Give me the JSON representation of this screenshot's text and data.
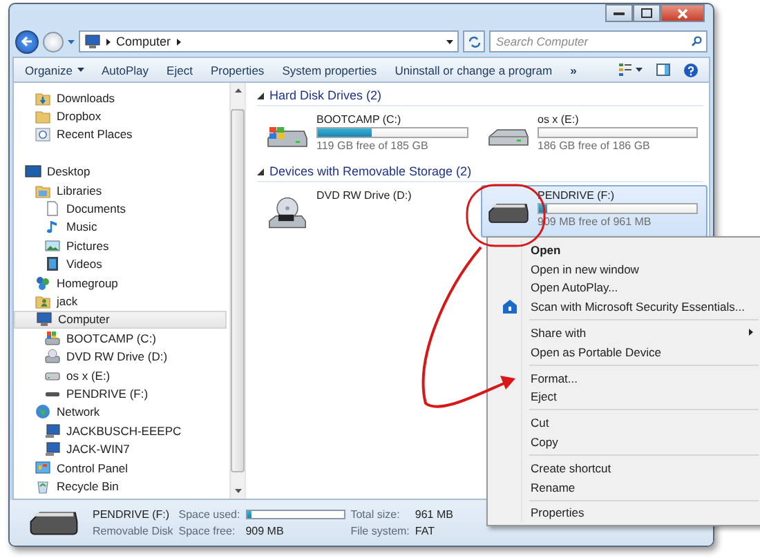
{
  "address_bar": {
    "path": [
      "Computer"
    ]
  },
  "search": {
    "placeholder": "Search Computer"
  },
  "toolbar": {
    "buttons": [
      {
        "label": "Organize",
        "kind": "dropdown"
      },
      {
        "label": "AutoPlay",
        "kind": "plain"
      },
      {
        "label": "Eject",
        "kind": "plain"
      },
      {
        "label": "Properties",
        "kind": "plain"
      },
      {
        "label": "System properties",
        "kind": "plain"
      },
      {
        "label": "Uninstall or change a program",
        "kind": "plain"
      }
    ],
    "overflow": "»"
  },
  "sidebar": {
    "favorites": [
      {
        "label": "Downloads",
        "kind": "downloads",
        "selected": false
      },
      {
        "label": "Dropbox",
        "kind": "folder",
        "selected": false
      },
      {
        "label": "Recent Places",
        "kind": "recent",
        "selected": false
      }
    ],
    "tree": [
      {
        "label": "Desktop",
        "kind": "desktop",
        "selected": false,
        "children": [
          {
            "label": "Libraries",
            "kind": "library",
            "selected": false,
            "children": [
              {
                "label": "Documents",
                "kind": "document",
                "selected": false
              },
              {
                "label": "Music",
                "kind": "music",
                "selected": false
              },
              {
                "label": "Pictures",
                "kind": "picture",
                "selected": false
              },
              {
                "label": "Videos",
                "kind": "video",
                "selected": false
              }
            ]
          },
          {
            "label": "Homegroup",
            "kind": "homegroup",
            "selected": false
          },
          {
            "label": "jack",
            "kind": "user",
            "selected": false
          },
          {
            "label": "Computer",
            "kind": "computer",
            "selected": true,
            "children": [
              {
                "label": "BOOTCAMP (C:)",
                "kind": "os-drive",
                "selected": false
              },
              {
                "label": "DVD RW Drive (D:)",
                "kind": "dvd",
                "selected": false
              },
              {
                "label": "os x (E:)",
                "kind": "drive",
                "selected": false
              },
              {
                "label": "PENDRIVE (F:)",
                "kind": "usb",
                "selected": false
              }
            ]
          },
          {
            "label": "Network",
            "kind": "network",
            "selected": false,
            "children": [
              {
                "label": "JACKBUSCH-EEEPC",
                "kind": "pc",
                "selected": false
              },
              {
                "label": "JACK-WIN7",
                "kind": "pc",
                "selected": false
              }
            ]
          },
          {
            "label": "Control Panel",
            "kind": "control-panel",
            "selected": false
          },
          {
            "label": "Recycle Bin",
            "kind": "recycle",
            "selected": false
          }
        ]
      }
    ]
  },
  "groups": [
    {
      "title": "Hard Disk Drives (2)",
      "drives": [
        {
          "name": "BOOTCAMP (C:)",
          "kind": "os-drive",
          "level": 0.36,
          "free": "119 GB free of 185 GB",
          "selected": false
        },
        {
          "name": "os x (E:)",
          "kind": "drive",
          "level": 0.0,
          "free": "186 GB free of 186 GB",
          "selected": false
        }
      ]
    },
    {
      "title": "Devices with Removable Storage (2)",
      "drives": [
        {
          "name": "DVD RW Drive (D:)",
          "kind": "dvd",
          "selected": false
        },
        {
          "name": "PENDRIVE (F:)",
          "kind": "usb",
          "level": 0.05,
          "free": "909 MB free of 961 MB",
          "selected": true
        }
      ]
    }
  ],
  "details": {
    "name": "PENDRIVE (F:)",
    "type": "Removable Disk",
    "used_label": "Space used:",
    "level": 0.05,
    "free_label": "Space free:",
    "free": "909 MB",
    "total_label": "Total size:",
    "total": "961 MB",
    "fs_label": "File system:",
    "fs": "FAT"
  },
  "context_menu": {
    "sections": [
      {
        "items": [
          {
            "label": "Open",
            "bold": true,
            "submenu": false,
            "kind": "plain"
          },
          {
            "label": "Open in new window",
            "bold": false,
            "submenu": false,
            "kind": "plain"
          },
          {
            "label": "Open AutoPlay...",
            "bold": false,
            "submenu": false,
            "kind": "plain"
          },
          {
            "label": "Scan with Microsoft Security Essentials...",
            "bold": false,
            "submenu": false,
            "kind": "shield"
          }
        ]
      },
      {
        "items": [
          {
            "label": "Share with",
            "bold": false,
            "submenu": true,
            "kind": "plain"
          },
          {
            "label": "Open as Portable Device",
            "bold": false,
            "submenu": false,
            "kind": "plain"
          }
        ]
      },
      {
        "items": [
          {
            "label": "Format...",
            "bold": false,
            "submenu": false,
            "kind": "plain"
          },
          {
            "label": "Eject",
            "bold": false,
            "submenu": false,
            "kind": "plain"
          }
        ]
      },
      {
        "items": [
          {
            "label": "Cut",
            "bold": false,
            "submenu": false,
            "kind": "plain"
          },
          {
            "label": "Copy",
            "bold": false,
            "submenu": false,
            "kind": "plain"
          }
        ]
      },
      {
        "items": [
          {
            "label": "Create shortcut",
            "bold": false,
            "submenu": false,
            "kind": "plain"
          },
          {
            "label": "Rename",
            "bold": false,
            "submenu": false,
            "kind": "plain"
          }
        ]
      },
      {
        "items": [
          {
            "label": "Properties",
            "bold": false,
            "submenu": false,
            "kind": "plain"
          }
        ]
      }
    ]
  }
}
